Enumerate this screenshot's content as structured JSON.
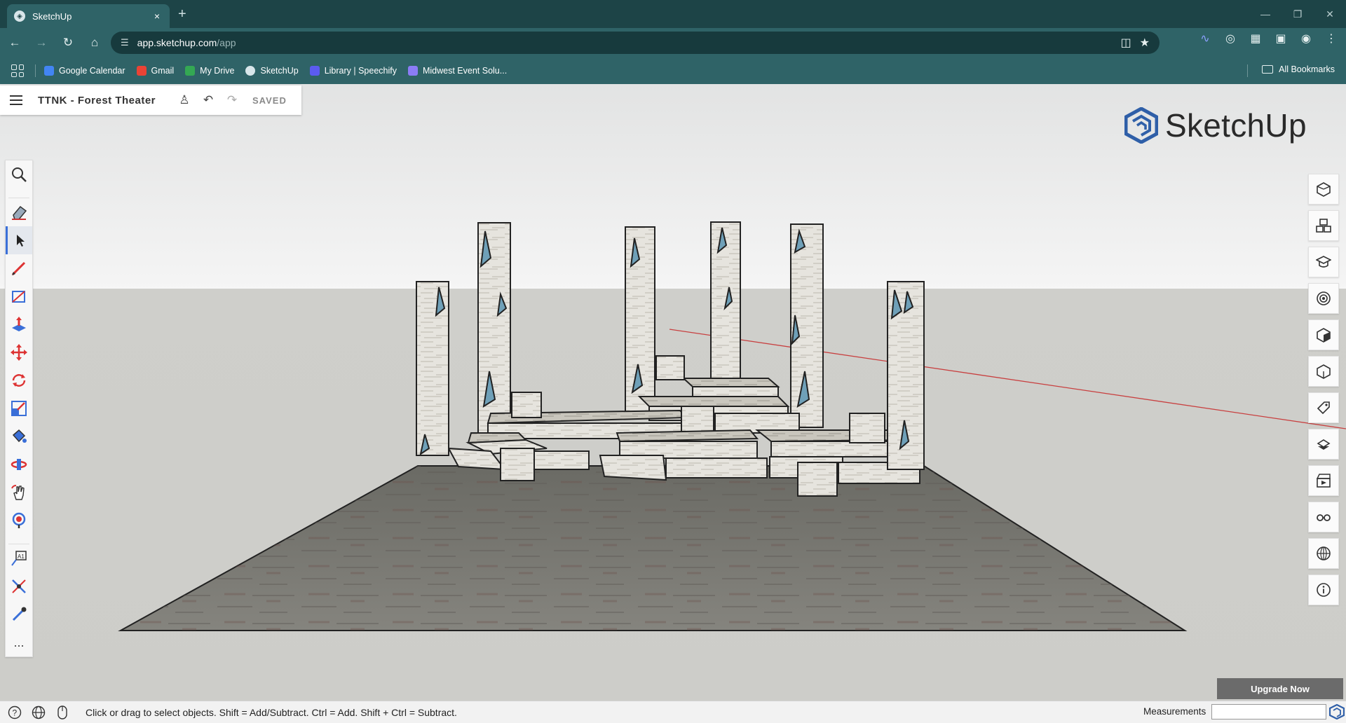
{
  "browser": {
    "tab_title": "SketchUp",
    "tab_close": "×",
    "new_tab": "+",
    "url_host": "app.sketchup.com",
    "url_path": "/app",
    "bookmarks": [
      {
        "label": "Google Calendar",
        "color": "#4285f4"
      },
      {
        "label": "Gmail",
        "color": "#ea4335"
      },
      {
        "label": "My Drive",
        "color": "#34a853"
      },
      {
        "label": "SketchUp",
        "color": "#d8e6ea"
      },
      {
        "label": "Library | Speechify",
        "color": "#5b5bf0"
      },
      {
        "label": "Midwest Event Solu...",
        "color": "#8b7cf6"
      }
    ],
    "all_bookmarks": "All Bookmarks"
  },
  "app": {
    "doc_title": "TTNK - Forest Theater",
    "saved_label": "SAVED",
    "logo_text": "SketchUp",
    "accent": "#3a6fd8",
    "logo_color": "#2f5fa8",
    "left_tools": [
      "search-icon",
      "eraser-icon",
      "select-icon",
      "pencil-icon",
      "rectangle-icon",
      "push-pull-icon",
      "move-icon",
      "rotate-icon",
      "scale-icon",
      "paint-bucket-icon",
      "orbit-icon",
      "pan-icon",
      "zoom-extents-icon",
      "text-tag-icon",
      "measure-icon",
      "eyedropper-icon",
      "more-icon"
    ],
    "right_tools": [
      "entity-info-icon",
      "components-icon",
      "instructor-icon",
      "materials-icon",
      "styles-icon",
      "layers-icon",
      "tags-icon",
      "scenes-icon",
      "animation-icon",
      "display-icon",
      "shadows-icon",
      "info-icon"
    ],
    "more_label": "...",
    "upgrade_label": "Upgrade Now",
    "status_text": "Click or drag to select objects. Shift = Add/Subtract. Ctrl = Add. Shift + Ctrl = Subtract.",
    "measurements_label": "Measurements",
    "measurements_value": ""
  }
}
